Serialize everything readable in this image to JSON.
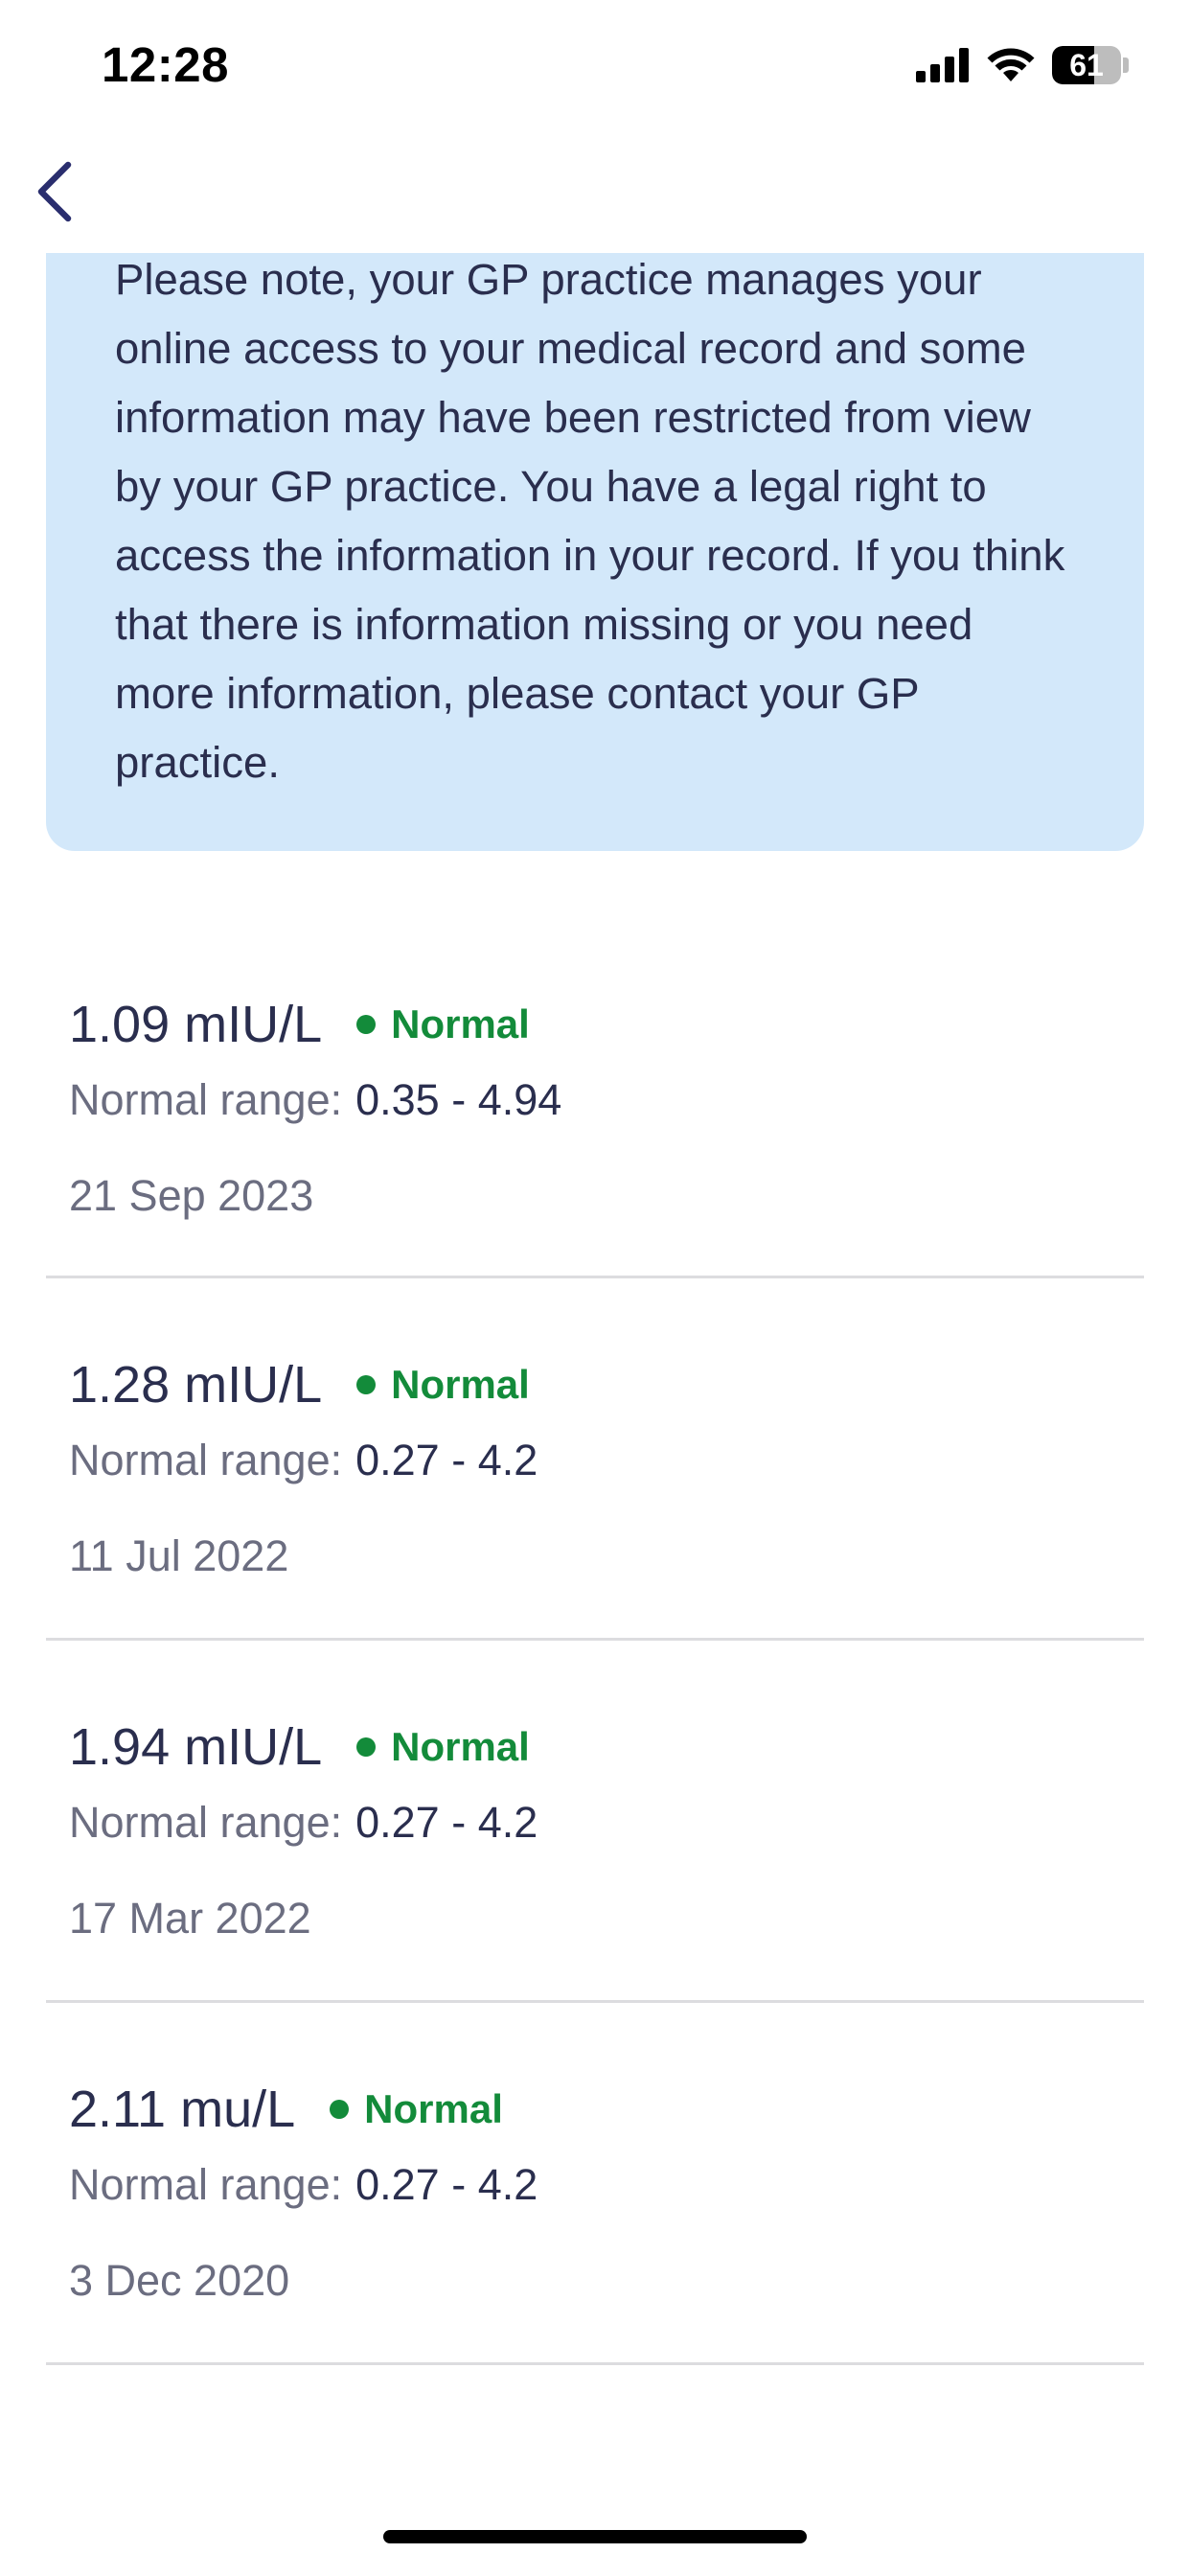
{
  "status_bar": {
    "time": "12:28",
    "battery_level": "61",
    "battery_fraction": 0.61,
    "icons": [
      "signal-icon",
      "wifi-icon",
      "battery-icon"
    ]
  },
  "nav": {
    "back_icon": "chevron-left-icon"
  },
  "notice": {
    "text": "Please note, your GP practice manages your online access to your medical record and some information may have been restricted from view by your GP practice. You have a legal right to access the information in your record. If you think that there is information missing or you need more information, please contact your GP practice."
  },
  "results": [
    {
      "value": "1.09 mIU/L",
      "status": "Normal",
      "range_label": "Normal range:",
      "range": "0.35 - 4.94",
      "date": "21 Sep 2023"
    },
    {
      "value": "1.28 mIU/L",
      "status": "Normal",
      "range_label": "Normal range:",
      "range": "0.27 - 4.2",
      "date": "11 Jul 2022"
    },
    {
      "value": "1.94 mIU/L",
      "status": "Normal",
      "range_label": "Normal range:",
      "range": "0.27 - 4.2",
      "date": "17 Mar 2022"
    },
    {
      "value": "2.11 mu/L",
      "status": "Normal",
      "range_label": "Normal range:",
      "range": "0.27 - 4.2",
      "date": "3 Dec 2020"
    }
  ],
  "colors": {
    "text_primary": "#2a2e4e",
    "text_secondary": "#6b6d80",
    "status_normal": "#138b3a",
    "notice_background": "#d3e8fa",
    "divider": "#dcdcdf"
  }
}
